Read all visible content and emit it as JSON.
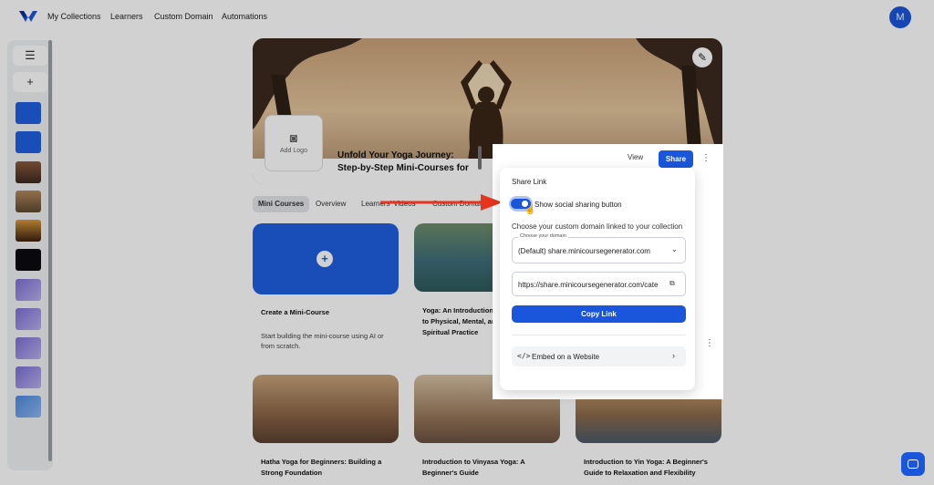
{
  "nav": {
    "links": [
      "My Collections",
      "Learners",
      "Custom Domain",
      "Automations"
    ],
    "avatar_initial": "M"
  },
  "sidebar": {
    "menu_icon": "hamburger-icon",
    "add_icon": "plus-icon",
    "menu_glyph": "☰",
    "add_glyph": "+"
  },
  "banner": {
    "add_logo_label": "Add Logo",
    "course_title": "Unfold Your Yoga Journey: Step-by-Step Mini-Courses for"
  },
  "tabs": [
    "Mini Courses",
    "Overview",
    "Learners' Videos",
    "Custom Domain"
  ],
  "cards": {
    "create": {
      "title": "Create a Mini-Course",
      "desc": "Start building the mini-course using AI or from scratch.",
      "plus": "+"
    },
    "c2_title": "Yoga: An Introduction to Physical, Mental, and Spiritual Practice",
    "row2": [
      {
        "title": "Hatha Yoga for Beginners: Building a Strong Foundation"
      },
      {
        "title": "Introduction to Vinyasa Yoga: A Beginner's Guide"
      },
      {
        "title": "Introduction to Yin Yoga: A Beginner's Guide to Relaxation and Flexibility"
      }
    ]
  },
  "header_actions": {
    "view": "View",
    "share": "Share",
    "kebab": "⋮"
  },
  "share_popover": {
    "title": "Share Link",
    "toggle_label": "Show social sharing button",
    "toggle_on": true,
    "choose_text": "Choose your custom domain linked to your collection",
    "select_legend": "Choose your domain",
    "select_value": "(Default) share.minicoursegenerator.com",
    "url_value": "https://share.minicoursegenerator.com/cate",
    "copy_button": "Copy Link",
    "embed_label": "Embed on a Website",
    "embed_glyph": "</>",
    "chevron_down": "⌄",
    "chevron_right": "›",
    "external_glyph": "⧉"
  },
  "colors": {
    "accent": "#1a56db",
    "arrow": "#e8341c"
  }
}
